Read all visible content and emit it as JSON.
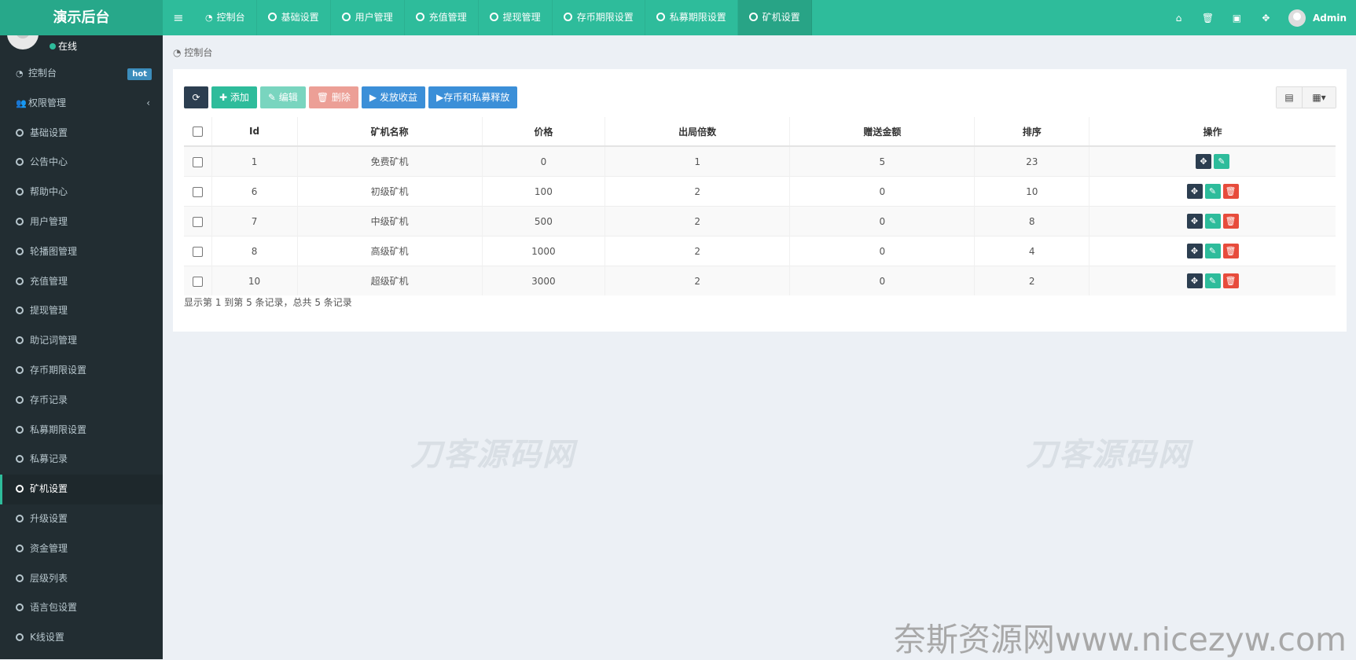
{
  "app": {
    "logo": "演示后台"
  },
  "topnav": {
    "toggle_icon": "≡",
    "tabs": [
      {
        "label": "控制台",
        "icon": "dashboard-icon"
      },
      {
        "label": "基础设置",
        "icon": "circle-icon"
      },
      {
        "label": "用户管理",
        "icon": "circle-icon"
      },
      {
        "label": "充值管理",
        "icon": "circle-icon"
      },
      {
        "label": "提现管理",
        "icon": "circle-icon"
      },
      {
        "label": "存币期限设置",
        "icon": "circle-icon"
      },
      {
        "label": "私募期限设置",
        "icon": "circle-icon"
      },
      {
        "label": "矿机设置",
        "icon": "circle-icon",
        "active": true
      }
    ],
    "right_icons": [
      "home-icon",
      "trash-icon",
      "language-icon",
      "fullscreen-icon"
    ],
    "user": "Admin"
  },
  "sidebar": {
    "status": "在线",
    "items": [
      {
        "label": "控制台",
        "icon": "dashboard-icon",
        "badge": "hot"
      },
      {
        "label": "权限管理",
        "icon": "users-icon"
      },
      {
        "label": "基础设置",
        "icon": "circle-icon"
      },
      {
        "label": "公告中心",
        "icon": "circle-icon"
      },
      {
        "label": "帮助中心",
        "icon": "circle-icon"
      },
      {
        "label": "用户管理",
        "icon": "circle-icon"
      },
      {
        "label": "轮播图管理",
        "icon": "circle-icon"
      },
      {
        "label": "充值管理",
        "icon": "circle-icon"
      },
      {
        "label": "提现管理",
        "icon": "circle-icon"
      },
      {
        "label": "助记词管理",
        "icon": "circle-icon"
      },
      {
        "label": "存币期限设置",
        "icon": "circle-icon"
      },
      {
        "label": "存币记录",
        "icon": "circle-icon"
      },
      {
        "label": "私募期限设置",
        "icon": "circle-icon"
      },
      {
        "label": "私募记录",
        "icon": "circle-icon"
      },
      {
        "label": "矿机设置",
        "icon": "circle-icon",
        "active": true
      },
      {
        "label": "升级设置",
        "icon": "circle-icon"
      },
      {
        "label": "资金管理",
        "icon": "circle-icon"
      },
      {
        "label": "层级列表",
        "icon": "circle-icon"
      },
      {
        "label": "语言包设置",
        "icon": "circle-icon"
      },
      {
        "label": "K线设置",
        "icon": "circle-icon"
      }
    ]
  },
  "breadcrumb": "控制台",
  "toolbar": {
    "add": "添加",
    "edit": "编辑",
    "delete": "删除",
    "distribute": "发放收益",
    "release": "存币和私募释放"
  },
  "table": {
    "columns": [
      "Id",
      "矿机名称",
      "价格",
      "出局倍数",
      "赠送金额",
      "排序",
      "操作"
    ],
    "rows": [
      {
        "id": "1",
        "name": "免费矿机",
        "price": "0",
        "multiple": "1",
        "gift": "5",
        "sort": "23",
        "ops": [
          "move",
          "edit"
        ]
      },
      {
        "id": "6",
        "name": "初级矿机",
        "price": "100",
        "multiple": "2",
        "gift": "0",
        "sort": "10",
        "ops": [
          "move",
          "edit",
          "delete"
        ]
      },
      {
        "id": "7",
        "name": "中级矿机",
        "price": "500",
        "multiple": "2",
        "gift": "0",
        "sort": "8",
        "ops": [
          "move",
          "edit",
          "delete"
        ]
      },
      {
        "id": "8",
        "name": "高级矿机",
        "price": "1000",
        "multiple": "2",
        "gift": "0",
        "sort": "4",
        "ops": [
          "move",
          "edit",
          "delete"
        ]
      },
      {
        "id": "10",
        "name": "超级矿机",
        "price": "3000",
        "multiple": "2",
        "gift": "0",
        "sort": "2",
        "ops": [
          "move",
          "edit",
          "delete"
        ]
      }
    ],
    "summary": "显示第 1 到第 5 条记录，总共 5 条记录"
  },
  "watermarks": {
    "center": "刀客源码网",
    "bottom": "奈斯资源网www.nicezyw.com"
  },
  "colors": {
    "accent": "#2ebc9b",
    "sidebar": "#222d32",
    "danger": "#e74c3c",
    "primary": "#3b8fd8"
  }
}
